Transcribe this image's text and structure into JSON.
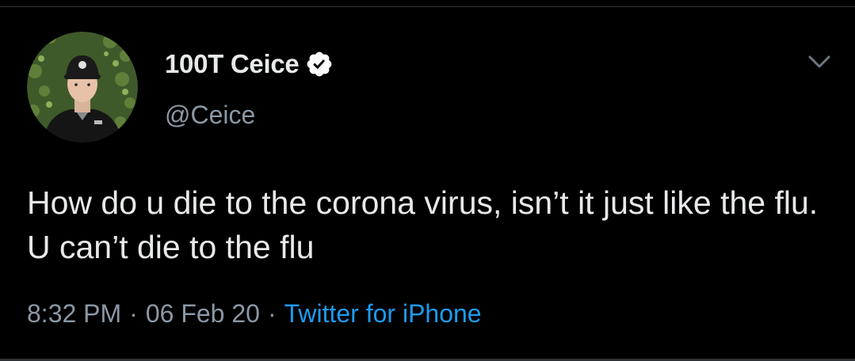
{
  "tweet": {
    "display_name": "100T Ceice",
    "handle": "@Ceice",
    "verified": true,
    "text": "How do u die to the corona virus, isn’t it just like the flu. U can’t die to the flu",
    "time": "8:32 PM",
    "date": "06 Feb 20",
    "separator": "·",
    "source": "Twitter for iPhone"
  },
  "icons": {
    "avatar": "profile-photo",
    "verified": "verified-badge-icon",
    "menu": "chevron-down-icon"
  },
  "colors": {
    "background": "#000000",
    "primary_text": "#e7e9ea",
    "secondary_text": "#8b98a5",
    "link": "#1d9bf0"
  }
}
